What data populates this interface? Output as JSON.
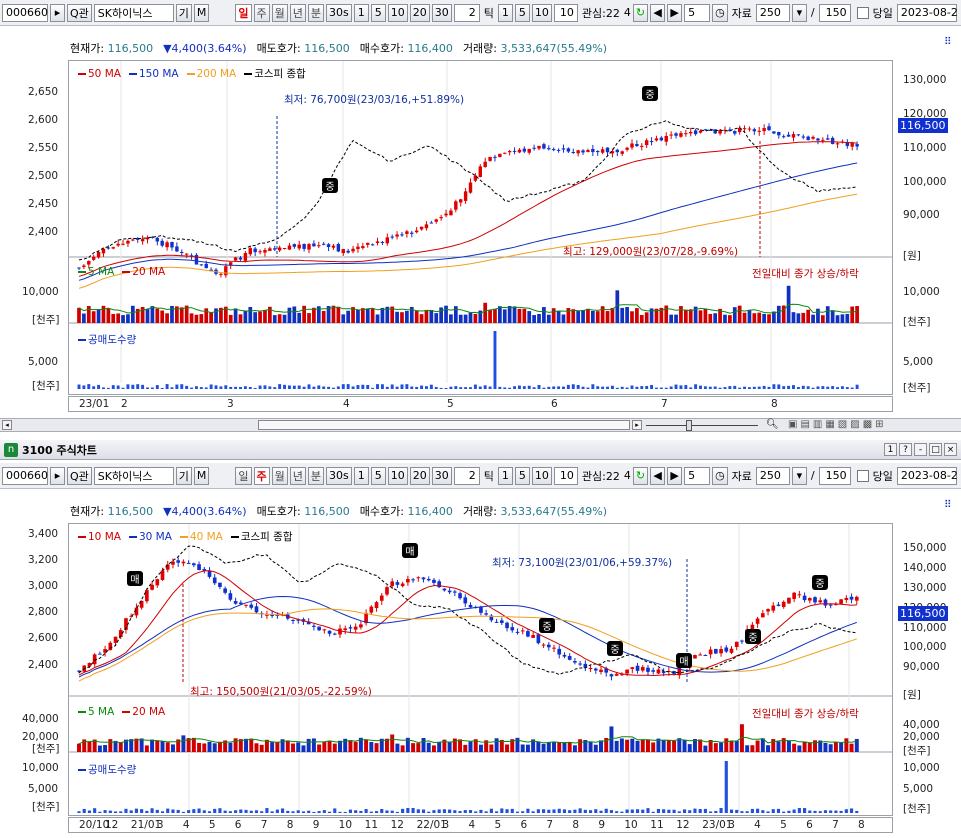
{
  "top": {
    "toolbar": {
      "code": "000660",
      "search_btn": "Q관",
      "stock_name": "SK하이닉스",
      "stock_extra1": "기",
      "stock_extra2": "M",
      "periods": [
        "일",
        "주",
        "월",
        "년",
        "분",
        "30s",
        "1",
        "5",
        "10",
        "20",
        "30"
      ],
      "active_period": "일",
      "tick_value": "2",
      "tick_label": "틱",
      "tick_btns": [
        "1",
        "5",
        "10"
      ],
      "tick_input": "10",
      "watch": "관심:22",
      "watch_suffix": "4",
      "nav_input": "5",
      "data_label": "자료",
      "data_count": "250",
      "slash": "/",
      "total": "150",
      "today_label": "당일",
      "date": "2023-08-2"
    },
    "info": {
      "price_label": "현재가:",
      "price": "116,500",
      "change": "▼4,400(3.64%)",
      "ask_label": "매도호가:",
      "ask": "116,500",
      "bid_label": "매수호가:",
      "bid": "116,400",
      "vol_label": "거래량:",
      "vol": "3,533,647(55.49%)"
    },
    "legend": [
      "50 MA",
      "150 MA",
      "200 MA",
      "코스피 종합"
    ],
    "legend_colors": [
      "#d00000",
      "#1030c0",
      "#f0a020",
      "#000000"
    ],
    "left_axis": [
      "2,650",
      "2,600",
      "2,550",
      "2,500",
      "2,450",
      "2,400"
    ],
    "right_axis": [
      "130,000",
      "120,000",
      "110,000",
      "100,000",
      "90,000",
      "[원]"
    ],
    "current_price_box": "116,500",
    "note_low": "최저: 76,700원(23/03/16,+51.89%)",
    "note_high": "최고: 129,000원(23/07/28,-9.69%)",
    "signal_labels": [
      "중",
      "중"
    ],
    "vol_legend": [
      "5 MA",
      "20 MA"
    ],
    "vol_note": "전일대비 종가 상승/하락",
    "vol_left": [
      "10,000",
      "[천주]"
    ],
    "vol_right": [
      "10,000",
      "[천주]"
    ],
    "short_legend": "공매도수량",
    "short_left": [
      "5,000",
      "[천주]"
    ],
    "short_right": [
      "5,000",
      "[천주]"
    ],
    "x_labels": [
      "23/01",
      "2",
      "3",
      "4",
      "5",
      "6",
      "7",
      "8"
    ]
  },
  "window": {
    "title": "3100 주식차트",
    "btns": [
      "1",
      "?",
      "-",
      "□",
      "×"
    ]
  },
  "bottom": {
    "toolbar": {
      "code": "000660",
      "search_btn": "Q관",
      "stock_name": "SK하이닉스",
      "stock_extra1": "기",
      "stock_extra2": "M",
      "periods": [
        "일",
        "주",
        "월",
        "년",
        "분",
        "30s",
        "1",
        "5",
        "10",
        "20",
        "30"
      ],
      "active_period": "주",
      "tick_value": "2",
      "tick_label": "틱",
      "tick_btns": [
        "1",
        "5",
        "10"
      ],
      "tick_input": "10",
      "watch": "관심:22",
      "watch_suffix": "4",
      "nav_input": "5",
      "data_label": "자료",
      "data_count": "250",
      "slash": "/",
      "total": "150",
      "today_label": "당일",
      "date": "2023-08-2"
    },
    "info": {
      "price_label": "현재가:",
      "price": "116,500",
      "change": "▼4,400(3.64%)",
      "ask_label": "매도호가:",
      "ask": "116,500",
      "bid_label": "매수호가:",
      "bid": "116,400",
      "vol_label": "거래량:",
      "vol": "3,533,647(55.49%)"
    },
    "legend": [
      "10 MA",
      "30 MA",
      "40 MA",
      "코스피 종합"
    ],
    "legend_colors": [
      "#d00000",
      "#1030c0",
      "#f0a020",
      "#000000"
    ],
    "left_axis": [
      "3,400",
      "3,200",
      "3,000",
      "2,800",
      "2,600",
      "2,400"
    ],
    "right_axis": [
      "150,000",
      "140,000",
      "130,000",
      "120,000",
      "110,000",
      "100,000",
      "90,000",
      "[원]"
    ],
    "current_price_box": "116,500",
    "note_low": "최저: 73,100원(23/01/06,+59.37%)",
    "note_high": "최고: 150,500원(21/03/05,-22.59%)",
    "signal_labels": [
      "매",
      "매",
      "중",
      "중",
      "매",
      "중",
      "중"
    ],
    "vol_legend": [
      "5 MA",
      "20 MA"
    ],
    "vol_note": "전일대비 종가 상승/하락",
    "vol_left": [
      "40,000",
      "20,000",
      "[천주]"
    ],
    "vol_right": [
      "40,000",
      "20,000",
      "[천주]"
    ],
    "short_legend": "공매도수량",
    "short_left": [
      "10,000",
      "5,000",
      "[천주]"
    ],
    "short_right": [
      "10,000",
      "5,000",
      "[천주]"
    ],
    "x_labels": [
      "20/10",
      "12",
      "21/01",
      "3",
      "4",
      "5",
      "6",
      "7",
      "8",
      "9",
      "10",
      "11",
      "12",
      "22/01",
      "3",
      "4",
      "5",
      "6",
      "7",
      "8",
      "9",
      "10",
      "11",
      "12",
      "23/01",
      "3",
      "4",
      "5",
      "6",
      "7",
      "8"
    ]
  },
  "chart_data": [
    {
      "type": "candlestick",
      "title": "SK하이닉스 일봉",
      "period": "daily",
      "price_range": [
        76000,
        135000
      ],
      "kospi_range": [
        2350,
        2680
      ],
      "current_price": 116500,
      "low": {
        "price": 76700,
        "date": "23/03/16"
      },
      "high": {
        "price": 129000,
        "date": "23/07/28"
      },
      "series": [
        {
          "name": "50 MA"
        },
        {
          "name": "150 MA"
        },
        {
          "name": "200 MA"
        },
        {
          "name": "코스피 종합"
        }
      ]
    },
    {
      "type": "candlestick",
      "title": "SK하이닉스 주봉",
      "period": "weekly",
      "price_range": [
        70000,
        155000
      ],
      "kospi_range": [
        2250,
        3450
      ],
      "current_price": 116500,
      "low": {
        "price": 73100,
        "date": "23/01/06"
      },
      "high": {
        "price": 150500,
        "date": "21/03/05"
      },
      "series": [
        {
          "name": "10 MA"
        },
        {
          "name": "30 MA"
        },
        {
          "name": "40 MA"
        },
        {
          "name": "코스피 종합"
        }
      ]
    }
  ]
}
